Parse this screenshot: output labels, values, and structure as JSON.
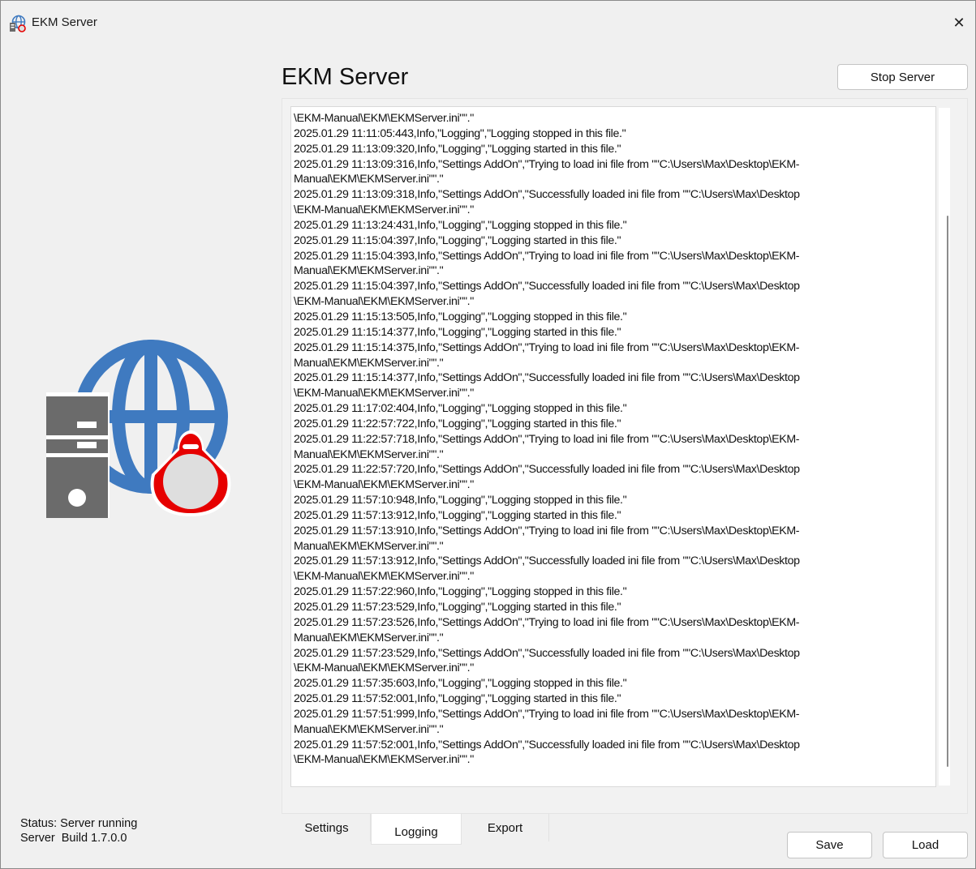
{
  "window": {
    "title": "EKM Server",
    "close_glyph": "✕",
    "icon": "app-icon"
  },
  "header": {
    "title": "EKM Server",
    "stop_button": "Stop Server"
  },
  "log": {
    "lines": [
      "\\EKM-Manual\\EKM\\EKMServer.ini\"\".\"",
      "2025.01.29 11:11:05:443,Info,\"Logging\",\"Logging stopped in this file.\"",
      "2025.01.29 11:13:09:320,Info,\"Logging\",\"Logging started in this file.\"",
      "2025.01.29 11:13:09:316,Info,\"Settings AddOn\",\"Trying to load ini file from \"\"C:\\Users\\Max\\Desktop\\EKM-",
      "Manual\\EKM\\EKMServer.ini\"\".\"",
      "2025.01.29 11:13:09:318,Info,\"Settings AddOn\",\"Successfully loaded ini file from \"\"C:\\Users\\Max\\Desktop",
      "\\EKM-Manual\\EKM\\EKMServer.ini\"\".\"",
      "2025.01.29 11:13:24:431,Info,\"Logging\",\"Logging stopped in this file.\"",
      "2025.01.29 11:15:04:397,Info,\"Logging\",\"Logging started in this file.\"",
      "2025.01.29 11:15:04:393,Info,\"Settings AddOn\",\"Trying to load ini file from \"\"C:\\Users\\Max\\Desktop\\EKM-",
      "Manual\\EKM\\EKMServer.ini\"\".\"",
      "2025.01.29 11:15:04:397,Info,\"Settings AddOn\",\"Successfully loaded ini file from \"\"C:\\Users\\Max\\Desktop",
      "\\EKM-Manual\\EKM\\EKMServer.ini\"\".\"",
      "2025.01.29 11:15:13:505,Info,\"Logging\",\"Logging stopped in this file.\"",
      "2025.01.29 11:15:14:377,Info,\"Logging\",\"Logging started in this file.\"",
      "2025.01.29 11:15:14:375,Info,\"Settings AddOn\",\"Trying to load ini file from \"\"C:\\Users\\Max\\Desktop\\EKM-",
      "Manual\\EKM\\EKMServer.ini\"\".\"",
      "2025.01.29 11:15:14:377,Info,\"Settings AddOn\",\"Successfully loaded ini file from \"\"C:\\Users\\Max\\Desktop",
      "\\EKM-Manual\\EKM\\EKMServer.ini\"\".\"",
      "2025.01.29 11:17:02:404,Info,\"Logging\",\"Logging stopped in this file.\"",
      "2025.01.29 11:22:57:722,Info,\"Logging\",\"Logging started in this file.\"",
      "2025.01.29 11:22:57:718,Info,\"Settings AddOn\",\"Trying to load ini file from \"\"C:\\Users\\Max\\Desktop\\EKM-",
      "Manual\\EKM\\EKMServer.ini\"\".\"",
      "2025.01.29 11:22:57:720,Info,\"Settings AddOn\",\"Successfully loaded ini file from \"\"C:\\Users\\Max\\Desktop",
      "\\EKM-Manual\\EKM\\EKMServer.ini\"\".\"",
      "2025.01.29 11:57:10:948,Info,\"Logging\",\"Logging stopped in this file.\"",
      "2025.01.29 11:57:13:912,Info,\"Logging\",\"Logging started in this file.\"",
      "2025.01.29 11:57:13:910,Info,\"Settings AddOn\",\"Trying to load ini file from \"\"C:\\Users\\Max\\Desktop\\EKM-",
      "Manual\\EKM\\EKMServer.ini\"\".\"",
      "2025.01.29 11:57:13:912,Info,\"Settings AddOn\",\"Successfully loaded ini file from \"\"C:\\Users\\Max\\Desktop",
      "\\EKM-Manual\\EKM\\EKMServer.ini\"\".\"",
      "2025.01.29 11:57:22:960,Info,\"Logging\",\"Logging stopped in this file.\"",
      "2025.01.29 11:57:23:529,Info,\"Logging\",\"Logging started in this file.\"",
      "2025.01.29 11:57:23:526,Info,\"Settings AddOn\",\"Trying to load ini file from \"\"C:\\Users\\Max\\Desktop\\EKM-",
      "Manual\\EKM\\EKMServer.ini\"\".\"",
      "2025.01.29 11:57:23:529,Info,\"Settings AddOn\",\"Successfully loaded ini file from \"\"C:\\Users\\Max\\Desktop",
      "\\EKM-Manual\\EKM\\EKMServer.ini\"\".\"",
      "2025.01.29 11:57:35:603,Info,\"Logging\",\"Logging stopped in this file.\"",
      "2025.01.29 11:57:52:001,Info,\"Logging\",\"Logging started in this file.\"",
      "2025.01.29 11:57:51:999,Info,\"Settings AddOn\",\"Trying to load ini file from \"\"C:\\Users\\Max\\Desktop\\EKM-",
      "Manual\\EKM\\EKMServer.ini\"\".\"",
      "2025.01.29 11:57:52:001,Info,\"Settings AddOn\",\"Successfully loaded ini file from \"\"C:\\Users\\Max\\Desktop",
      "\\EKM-Manual\\EKM\\EKMServer.ini\"\".\""
    ]
  },
  "tabs": [
    {
      "label": "Settings",
      "active": false
    },
    {
      "label": "Logging",
      "active": true
    },
    {
      "label": "Export",
      "active": false
    }
  ],
  "footer": {
    "save_button": "Save",
    "load_button": "Load"
  },
  "status": {
    "line1": "Status: Server running",
    "line2": "Server  Build 1.7.0.0"
  },
  "logo": {
    "icon": "server-globe-keyfob-icon",
    "colors": {
      "globe": "#3f7ac0",
      "server": "#6b6b6b",
      "keyfob": "#e60000",
      "keyfob_fill": "#dedede"
    }
  }
}
